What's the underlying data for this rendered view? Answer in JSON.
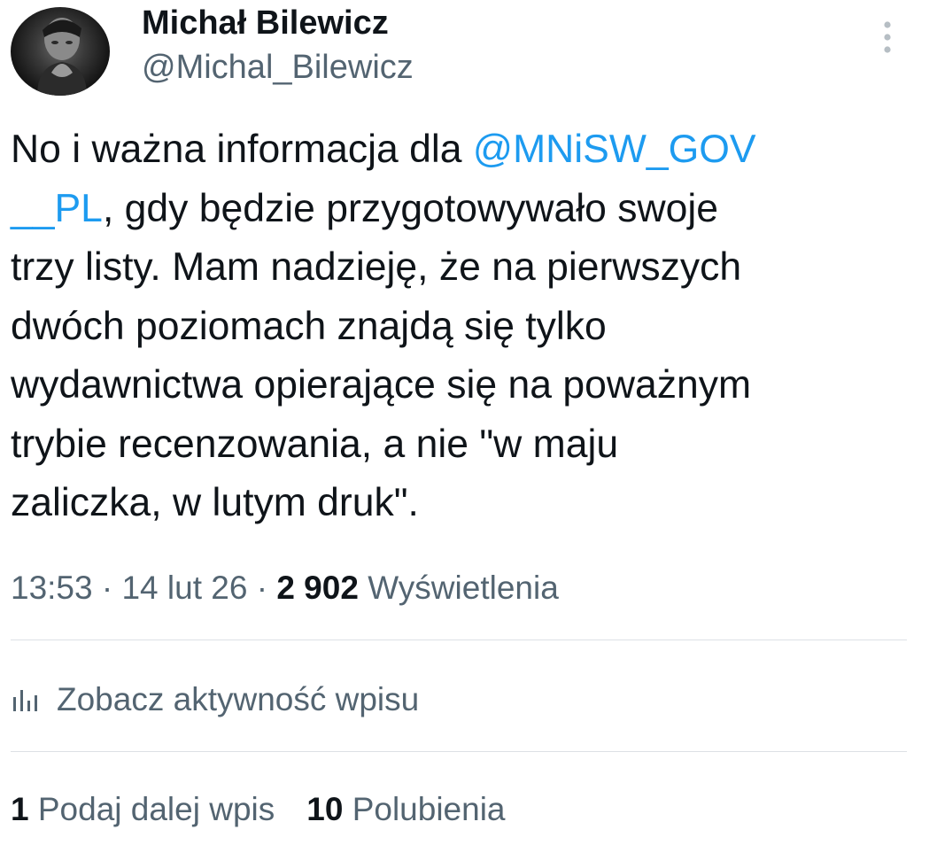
{
  "author": {
    "name": "Michał Bilewicz",
    "handle": "@Michal_Bilewicz"
  },
  "tweet": {
    "text_before_mention": "No i ważna informacja dla ",
    "mention": "@MNiSW_GOV\n__PL",
    "text_after_mention": ", gdy będzie przygotowywało swoje\ntrzy listy. Mam nadzieję, że na pierwszych\ndwóch poziomach znajdą się tylko\nwydawnictwa opierające się na poważnym\ntrybie recenzowania, a nie \"w maju\nzaliczka, w lutym druk\"."
  },
  "meta": {
    "time": "13:53",
    "separator": "·",
    "date": "14 lut 26",
    "views_count": "2 902",
    "views_label": "Wyświetlenia"
  },
  "activity": {
    "icon": "analytics-icon",
    "label": "Zobacz aktywność wpisu"
  },
  "stats": {
    "reposts_count": "1",
    "reposts_label": "Podaj dalej wpis",
    "likes_count": "10",
    "likes_label": "Polubienia"
  },
  "colors": {
    "link": "#1d9bf0",
    "secondary_text": "#536471",
    "primary_text": "#0f1419",
    "divider": "#dde1e5"
  }
}
